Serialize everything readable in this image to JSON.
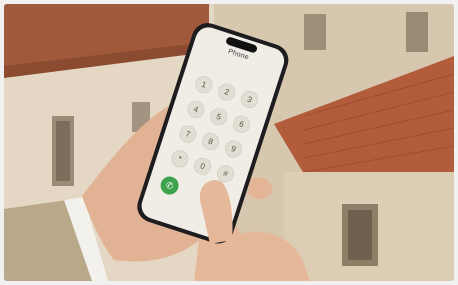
{
  "phone_app": {
    "title": "Phone",
    "keys": [
      "1",
      "2",
      "3",
      "4",
      "5",
      "6",
      "7",
      "8",
      "9",
      "*",
      "0",
      "#"
    ],
    "call_icon": "phone-call-icon"
  },
  "colors": {
    "call_button": "#3fa34d",
    "roof_tiles": "#b35c3c",
    "phone_body": "#1d1d1f"
  }
}
